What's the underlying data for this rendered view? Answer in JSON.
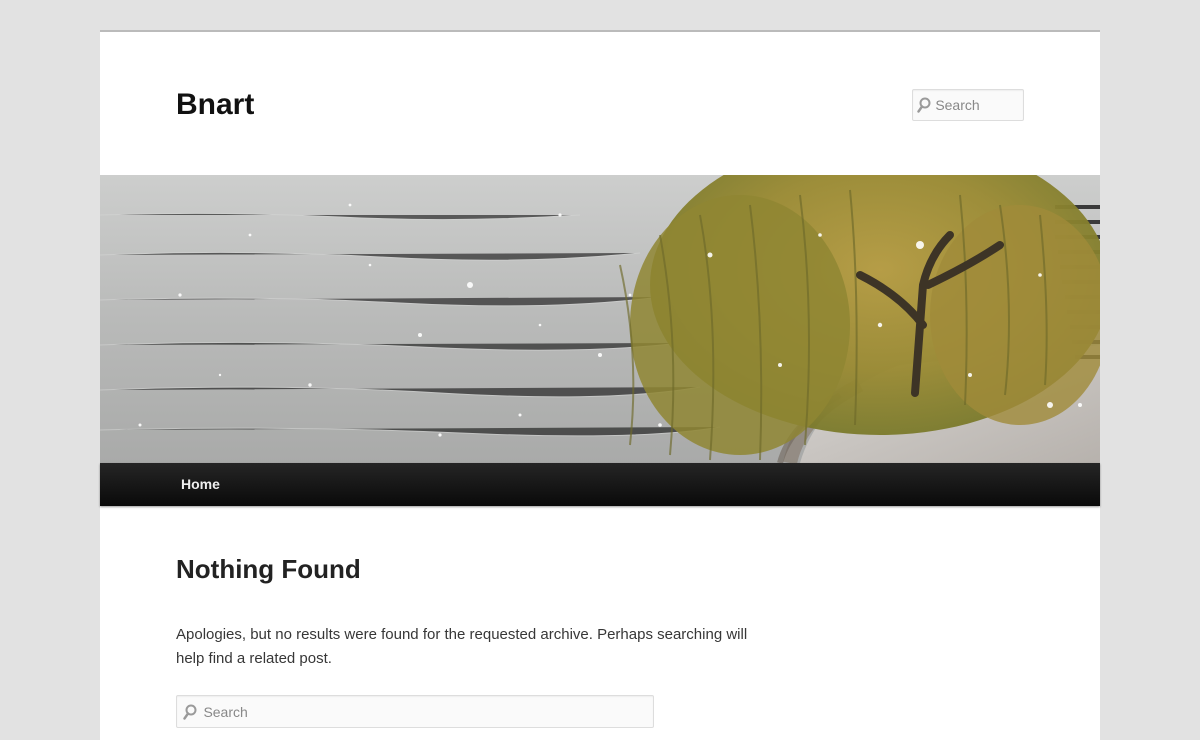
{
  "site": {
    "title": "Bnart"
  },
  "header_search": {
    "placeholder": "Search"
  },
  "header_image": {
    "description_icon": "lake-willow-snow-photo"
  },
  "nav": {
    "items": [
      {
        "label": "Home"
      }
    ]
  },
  "content": {
    "title": "Nothing Found",
    "message": "Apologies, but no results were found for the requested archive. Perhaps searching will help find a related post.",
    "search_placeholder": "Search"
  },
  "colors": {
    "page_background": "#e2e2e2",
    "content_background": "#ffffff",
    "nav_background": "#111111",
    "title_text": "#111111"
  }
}
